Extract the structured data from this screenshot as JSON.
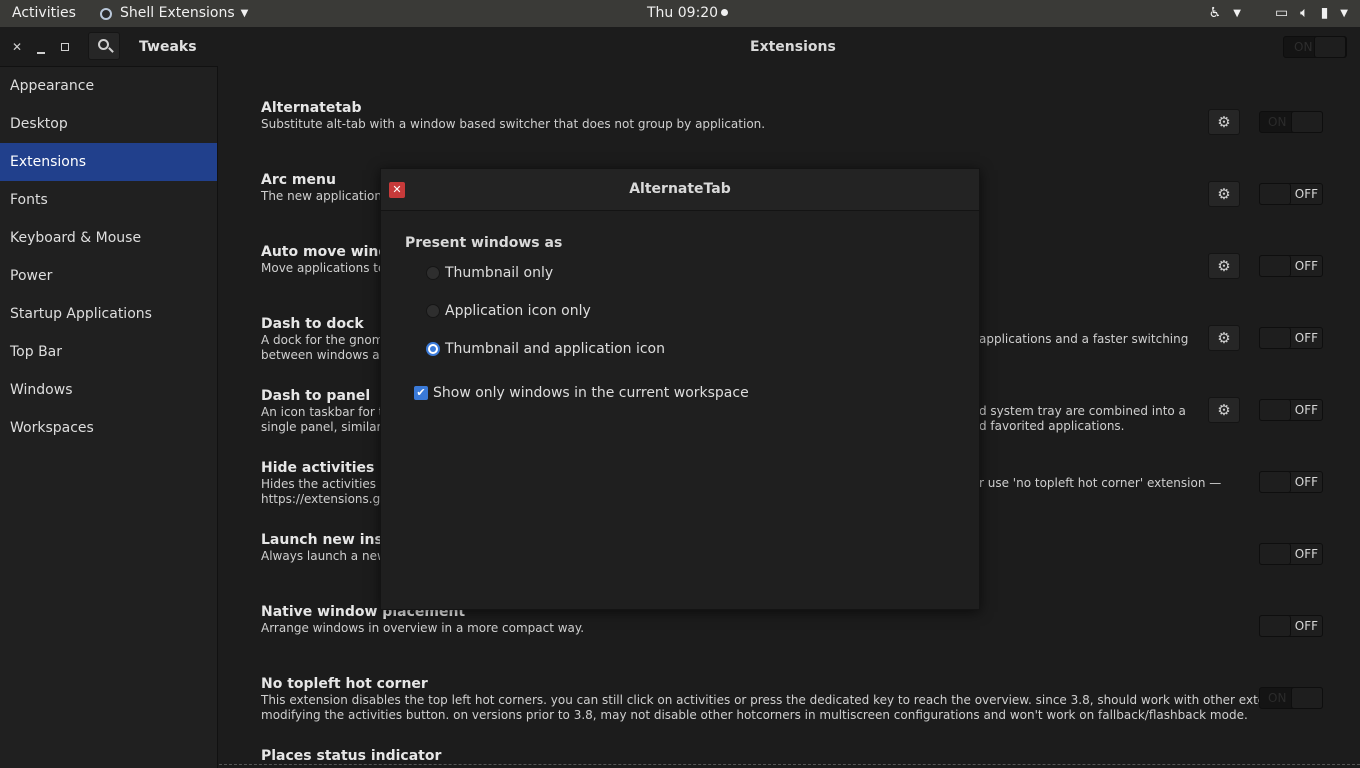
{
  "topbar": {
    "activities": "Activities",
    "app_name": "Shell Extensions",
    "clock": "Thu 09:20"
  },
  "header": {
    "app_title": "Tweaks",
    "page_title": "Extensions",
    "global_switch_label": "ON"
  },
  "sidebar": {
    "items": [
      {
        "label": "Appearance"
      },
      {
        "label": "Desktop"
      },
      {
        "label": "Extensions"
      },
      {
        "label": "Fonts"
      },
      {
        "label": "Keyboard & Mouse"
      },
      {
        "label": "Power"
      },
      {
        "label": "Startup Applications"
      },
      {
        "label": "Top Bar"
      },
      {
        "label": "Windows"
      },
      {
        "label": "Workspaces"
      }
    ],
    "active": "Extensions"
  },
  "extensions": [
    {
      "name": "Alternatetab",
      "desc1": "Substitute alt-tab with a window based switcher that does not group by application.",
      "desc2": "",
      "state": "ON"
    },
    {
      "name": "Arc menu",
      "desc1": "The new applications",
      "desc2": "",
      "state": "OFF"
    },
    {
      "name": "Auto move windo",
      "desc1": "Move applications to s",
      "desc2": "",
      "state": "OFF"
    },
    {
      "name": "Dash to dock",
      "desc1": "A dock for the gnome",
      "desc1b": "applications and a faster switching",
      "desc2": "between windows an",
      "state": "OFF"
    },
    {
      "name": "Dash to panel",
      "desc1": "An icon taskbar for th",
      "desc1b": "d system tray are combined into a",
      "desc2": "single panel, similar to",
      "desc2b": "d favorited applications.",
      "state": "OFF"
    },
    {
      "name": "Hide activities bu",
      "desc1": "Hides the activities bu",
      "desc1b": "r use 'no topleft hot corner' extension —",
      "desc2": "https://extensions.gn",
      "state": "OFF"
    },
    {
      "name": "Launch new insta",
      "desc1": "Always launch a new i",
      "desc2": "",
      "state": "OFF"
    },
    {
      "name": "Native window placement",
      "desc1": "Arrange windows in overview in a more compact way.",
      "desc2": "",
      "state": "OFF"
    },
    {
      "name": "No topleft hot corner",
      "desc1": "This extension disables the top left hot corners. you can still click on activities or press the dedicated key to reach the overview. since 3.8, should work with other extensions",
      "desc2": "modifying the activities button. on versions prior to 3.8, may not disable other hotcorners in multiscreen configurations and won't work on fallback/flashback mode.",
      "state": "ON"
    },
    {
      "name": "Places status indicator",
      "desc1": "",
      "desc2": "",
      "state": ""
    }
  ],
  "dialog": {
    "title": "AlternateTab",
    "section_label": "Present windows as",
    "options": [
      {
        "label": "Thumbnail only",
        "checked": false
      },
      {
        "label": "Application icon only",
        "checked": false
      },
      {
        "label": "Thumbnail and application icon",
        "checked": true
      }
    ],
    "checkbox_label": "Show only windows in the current workspace",
    "checkbox_checked": true
  },
  "colors": {
    "accent": "#21408c",
    "check_blue": "#3a7ad8",
    "close_red": "#c73a3a"
  }
}
